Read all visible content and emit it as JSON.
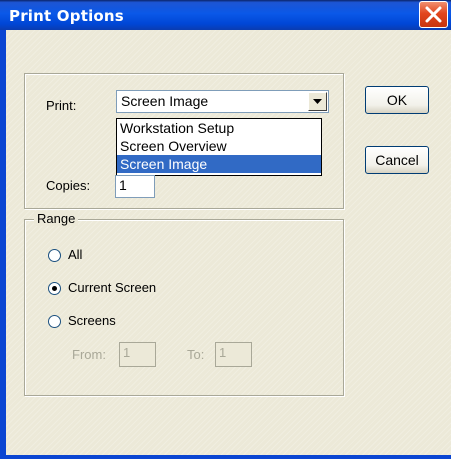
{
  "window": {
    "title": "Print Options"
  },
  "print_group": {
    "print_label": "Print:",
    "selected_value": "Screen Image",
    "options": [
      "Workstation Setup",
      "Screen Overview",
      "Screen Image"
    ],
    "copies_label": "Copies:",
    "copies_value": "1"
  },
  "buttons": {
    "ok": "OK",
    "cancel": "Cancel"
  },
  "range_group": {
    "legend": "Range",
    "options": [
      {
        "label": "All",
        "checked": false
      },
      {
        "label": "Current Screen",
        "checked": true
      },
      {
        "label": "Screens",
        "checked": false
      }
    ],
    "from_label": "From:",
    "from_value": "1",
    "to_label": "To:",
    "to_value": "1"
  },
  "colors": {
    "titlebar": "#0a58e8",
    "selection": "#316ac5",
    "dialog_bg": "#ece9d8"
  }
}
